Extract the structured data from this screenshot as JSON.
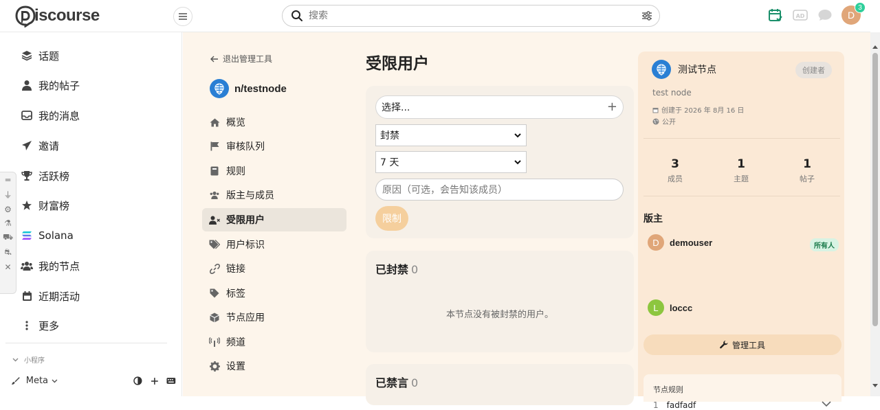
{
  "header": {
    "logo_text": "iscourse",
    "search_placeholder": "搜索",
    "notification_count": "3",
    "user_initial": "D"
  },
  "sidebar": {
    "items": [
      {
        "label": "话题",
        "icon": "layers-icon"
      },
      {
        "label": "我的帖子",
        "icon": "user-icon"
      },
      {
        "label": "我的消息",
        "icon": "inbox-icon"
      },
      {
        "label": "邀请",
        "icon": "paper-plane-icon"
      },
      {
        "label": "活跃榜",
        "icon": "trophy-icon"
      },
      {
        "label": "财富榜",
        "icon": "star-icon"
      },
      {
        "label": "Solana",
        "icon": "solana-icon"
      },
      {
        "label": "我的节点",
        "icon": "users-icon"
      },
      {
        "label": "近期活动",
        "icon": "calendar-icon"
      },
      {
        "label": "更多",
        "icon": "ellipsis-icon"
      }
    ],
    "mini_program": "小程序",
    "footer_meta": "Meta"
  },
  "admin_nav": {
    "exit_label": "退出管理工具",
    "node_name": "n/testnode",
    "items": [
      {
        "label": "概览",
        "icon": "home-icon"
      },
      {
        "label": "审核队列",
        "icon": "flag-icon"
      },
      {
        "label": "规则",
        "icon": "book-icon"
      },
      {
        "label": "版主与成员",
        "icon": "users-icon"
      },
      {
        "label": "受限用户",
        "icon": "user-restrict-icon"
      },
      {
        "label": "用户标识",
        "icon": "tags-icon"
      },
      {
        "label": "链接",
        "icon": "link-icon"
      },
      {
        "label": "标签",
        "icon": "tag-icon"
      },
      {
        "label": "节点应用",
        "icon": "cube-icon"
      },
      {
        "label": "频道",
        "icon": "broadcast-icon"
      },
      {
        "label": "设置",
        "icon": "gear-icon"
      }
    ],
    "active_index": 4
  },
  "content": {
    "title": "受限用户",
    "select_user_placeholder": "选择...",
    "action_select": "封禁",
    "duration_select": "7 天",
    "reason_placeholder": "原因（可选，会告知该成员）",
    "limit_button": "限制",
    "banned_title": "已封禁",
    "banned_count": "0",
    "banned_empty": "本节点没有被封禁的用户。",
    "muted_title": "已禁言",
    "muted_count": "0"
  },
  "right_panel": {
    "node_display_name": "测试节点",
    "creator_badge": "创建者",
    "description": "test node",
    "created_text": "创建于 2026 年 8月 16 日",
    "visibility": "公开",
    "stats": [
      {
        "value": "3",
        "label": "成员"
      },
      {
        "value": "1",
        "label": "主题"
      },
      {
        "value": "1",
        "label": "帖子"
      }
    ],
    "moderators_title": "版主",
    "members": [
      {
        "name": "demouser",
        "initial": "D",
        "color": "#e0a679",
        "badge": "所有人"
      },
      {
        "name": "loccc",
        "initial": "L",
        "color": "#8dc63f",
        "badge": ""
      }
    ],
    "manage_button": "管理工具",
    "rules_title": "节点规则",
    "rules": [
      {
        "index": "1",
        "text": "fadfadf"
      }
    ]
  },
  "colors": {
    "accent_green": "#2fcf9b",
    "main_bg": "#fdf5eb",
    "panel_bg": "#fbe9d6",
    "limit_button": "#f5cf9d"
  }
}
